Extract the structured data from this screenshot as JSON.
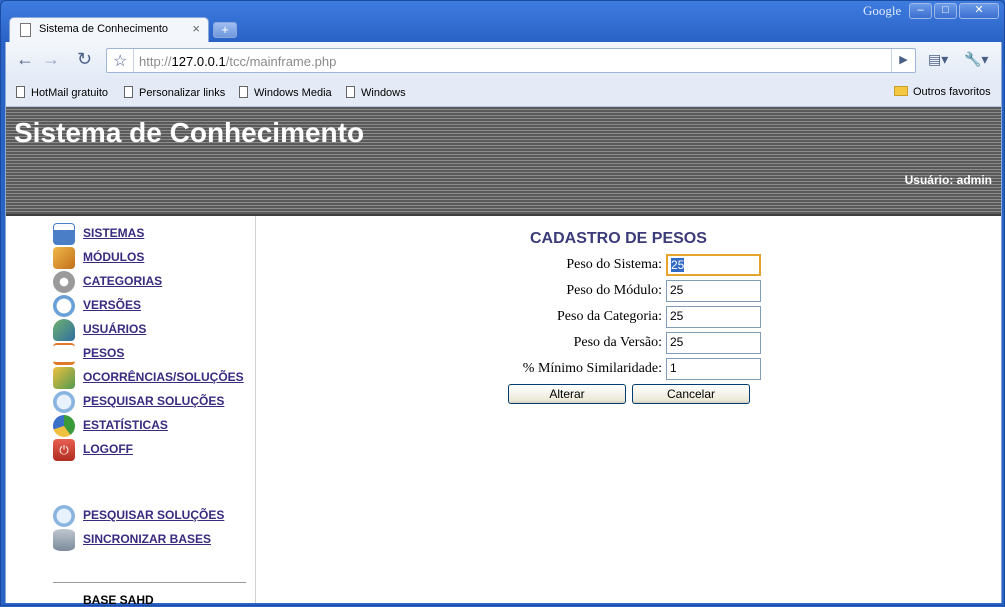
{
  "browser": {
    "brand": "Google",
    "tab_title": "Sistema de Conhecimento",
    "url_prefix": "http://",
    "url_host": "127.0.0.1",
    "url_path": "/tcc/mainframe.php",
    "bookmarks": [
      "HotMail gratuito",
      "Personalizar links",
      "Windows Media",
      "Windows"
    ],
    "other_bookmarks": "Outros favoritos"
  },
  "header": {
    "title": "Sistema de Conhecimento",
    "user": "Usuário: admin"
  },
  "sidebar": {
    "items": [
      {
        "label": "SISTEMAS",
        "icon": "window-icon",
        "color": "#4a7fc8"
      },
      {
        "label": "MÓDULOS",
        "icon": "cube-icon",
        "color": "#e0902a"
      },
      {
        "label": "CATEGORIAS",
        "icon": "gear-icon",
        "color": "#9a9a9a"
      },
      {
        "label": "VERSÕES",
        "icon": "clock-icon",
        "color": "#6aa0d8"
      },
      {
        "label": "USUÁRIOS",
        "icon": "users-icon",
        "color": "#3f8f3f"
      },
      {
        "label": "PESOS",
        "icon": "scale-icon",
        "color": "#e07a2a"
      },
      {
        "label": "OCORRÊNCIAS/SOLUÇÕES",
        "icon": "tools-icon",
        "color": "#4f9a4f"
      },
      {
        "label": "PESQUISAR SOLUÇÕES",
        "icon": "magnifier-icon",
        "color": "#8ab4e0"
      },
      {
        "label": "ESTATÍSTICAS",
        "icon": "pie-chart-icon",
        "color": "#3a9a3a"
      },
      {
        "label": "LOGOFF",
        "icon": "power-icon",
        "color": "#d04030"
      }
    ],
    "section_heading": "BASE SAHD",
    "section_items": [
      {
        "label": "PESQUISAR SOLUÇÕES",
        "icon": "magnifier-icon",
        "color": "#8ab4e0"
      },
      {
        "label": "SINCRONIZAR BASES",
        "icon": "database-sync-icon",
        "color": "#7a8a9a"
      }
    ]
  },
  "form": {
    "title": "CADASTRO DE PESOS",
    "fields": [
      {
        "label": "Peso do Sistema:",
        "value": "25"
      },
      {
        "label": "Peso do Módulo:",
        "value": "25"
      },
      {
        "label": "Peso da Categoria:",
        "value": "25"
      },
      {
        "label": "Peso da Versão:",
        "value": "25"
      },
      {
        "label": "% Mínimo Similaridade:",
        "value": "1"
      }
    ],
    "submit_label": "Alterar",
    "cancel_label": "Cancelar"
  }
}
